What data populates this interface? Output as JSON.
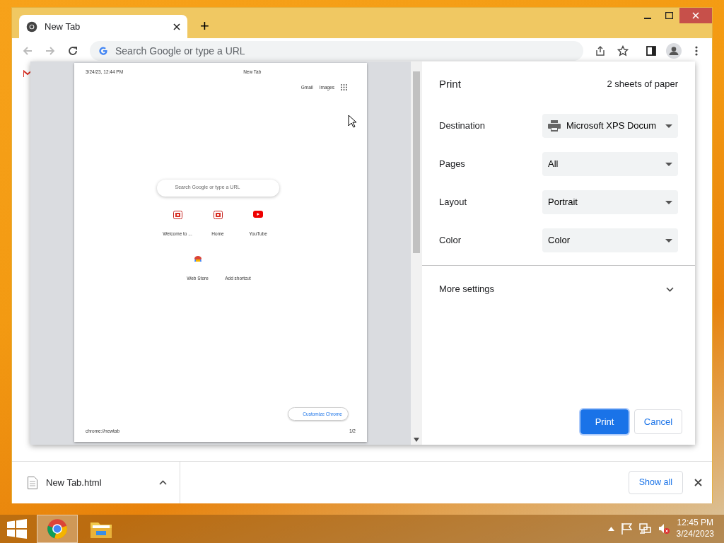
{
  "browser": {
    "tabs": [
      {
        "title": "New Tab",
        "selected": true
      }
    ],
    "new_tab": "+",
    "omnibox": {
      "placeholder": "Search Google or type a URL"
    }
  },
  "print_preview": {
    "header_date": "3/24/23, 12:44 PM",
    "header_title": "New Tab",
    "top_links": [
      "Gmail",
      "Images"
    ],
    "search": {
      "placeholder": "Search Google or type a URL"
    },
    "shortcuts": [
      {
        "label": "Welcome to ...",
        "kind": "site"
      },
      {
        "label": "Home",
        "kind": "site"
      },
      {
        "label": "YouTube",
        "kind": "youtube"
      },
      {
        "label": "Web Store",
        "kind": "webstore"
      },
      {
        "label": "Add shortcut",
        "kind": "add"
      }
    ],
    "customize": "Customize Chrome",
    "footer_url": "chrome://newtab",
    "page_number": "1/2"
  },
  "print": {
    "title": "Print",
    "sheets": "2 sheets of paper",
    "settings": [
      {
        "label": "Destination",
        "value": "Microsoft XPS Docum",
        "kind": "printer"
      },
      {
        "label": "Pages",
        "value": "All",
        "kind": "plain"
      },
      {
        "label": "Layout",
        "value": "Portrait",
        "kind": "plain"
      },
      {
        "label": "Color",
        "value": "Color",
        "kind": "plain"
      }
    ],
    "more_settings": "More settings",
    "expanded": false,
    "buttons": [
      {
        "label": "Print",
        "primary": true
      },
      {
        "label": "Cancel",
        "primary": false
      }
    ]
  },
  "downloads": {
    "items": [
      {
        "name": "New Tab.html"
      }
    ],
    "show_all": "Show all"
  },
  "taskbar": {
    "apps": [
      {
        "kind": "chrome",
        "selected": true
      },
      {
        "kind": "explorer",
        "selected": false
      }
    ],
    "time": "12:45 PM",
    "date": "3/24/2023"
  }
}
